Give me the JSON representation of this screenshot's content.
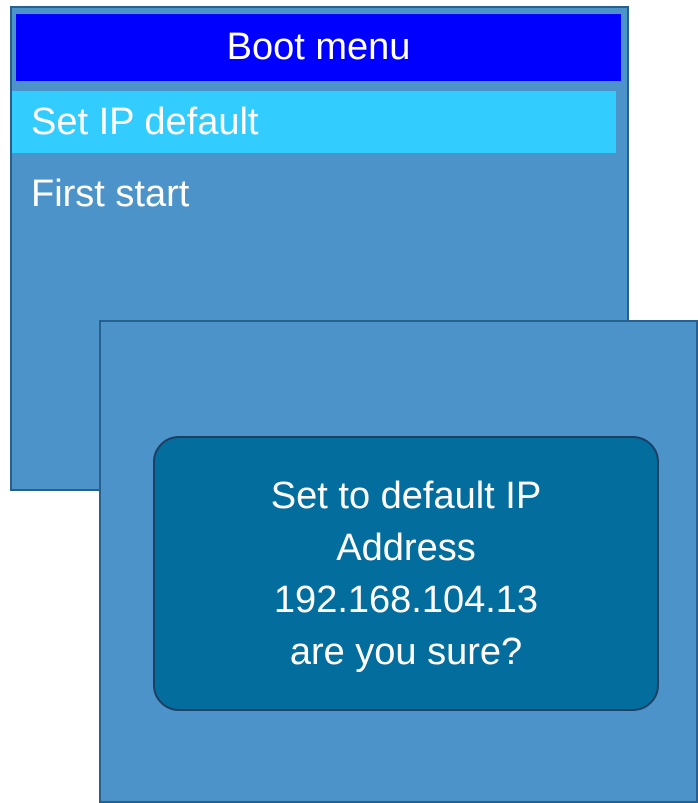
{
  "menu": {
    "title": "Boot menu",
    "items": [
      {
        "label": "Set IP default",
        "selected": true
      },
      {
        "label": "First start",
        "selected": false
      }
    ]
  },
  "dialog": {
    "lines": [
      "Set to default IP",
      "Address",
      "192.168.104.13",
      "are you sure?"
    ]
  },
  "colors": {
    "panel_background": "#4c93c9",
    "title_background": "#0000fe",
    "selected_item_background": "#33ccff",
    "dialog_background": "#036d9e",
    "text": "#ffffff"
  }
}
